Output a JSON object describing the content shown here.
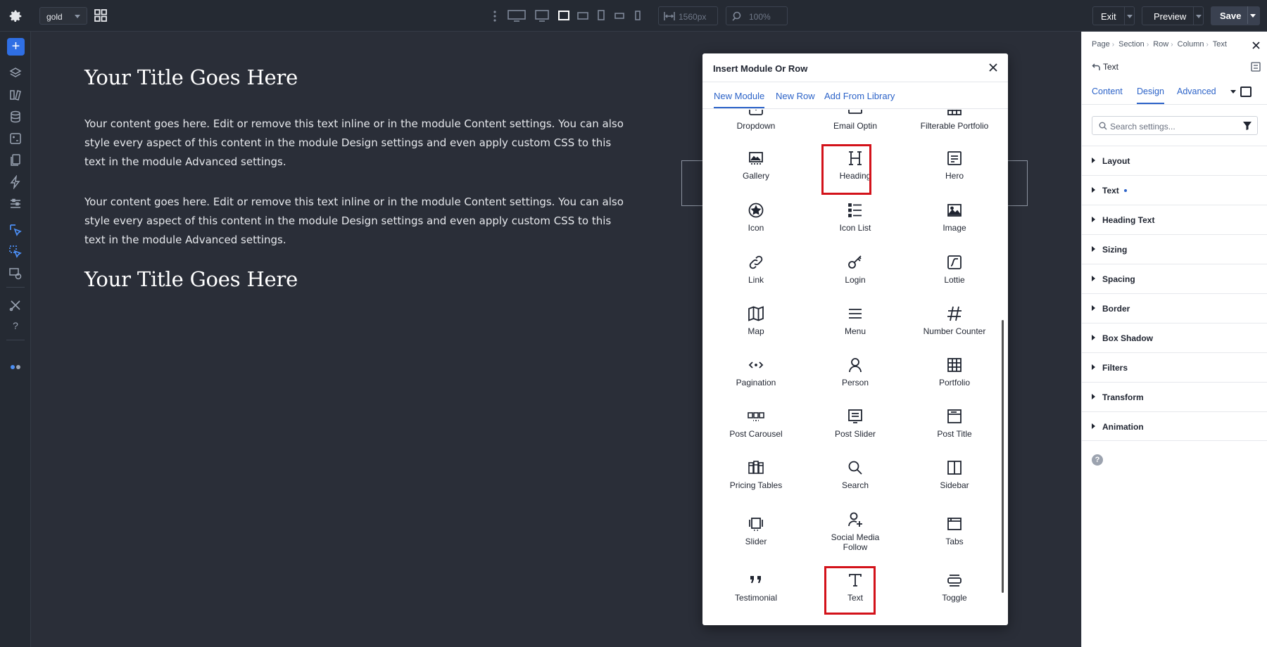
{
  "toolbar": {
    "layout_select": "gold",
    "width_value": "1560px",
    "zoom_value": "100%",
    "exit_label": "Exit",
    "preview_label": "Preview",
    "save_label": "Save"
  },
  "canvas": {
    "title_1": "Your Title Goes Here",
    "paragraph_1": "Your content goes here. Edit or remove this text inline or in the module Content settings. You can also style every aspect of this content in the module Design settings and even apply custom CSS to this text in the module Advanced settings.",
    "paragraph_2": "Your content goes here. Edit or remove this text inline or in the module Content settings. You can also style every aspect of this content in the module Design settings and even apply custom CSS to this text in the module Advanced settings.",
    "title_2": "Your Title Goes Here"
  },
  "modal": {
    "title": "Insert Module Or Row",
    "tabs": [
      "New Module",
      "New Row",
      "Add From Library"
    ],
    "modules": [
      {
        "label": "Dropdown",
        "icon": "dropdown-icon"
      },
      {
        "label": "Email Optin",
        "icon": "email-optin-icon"
      },
      {
        "label": "Filterable Portfolio",
        "icon": "filterable-portfolio-icon"
      },
      {
        "label": "Gallery",
        "icon": "gallery-icon"
      },
      {
        "label": "Heading",
        "icon": "heading-icon"
      },
      {
        "label": "Hero",
        "icon": "hero-icon"
      },
      {
        "label": "Icon",
        "icon": "star-circle-icon"
      },
      {
        "label": "Icon List",
        "icon": "icon-list-icon"
      },
      {
        "label": "Image",
        "icon": "image-icon"
      },
      {
        "label": "Link",
        "icon": "link-icon"
      },
      {
        "label": "Login",
        "icon": "key-icon"
      },
      {
        "label": "Lottie",
        "icon": "lottie-icon"
      },
      {
        "label": "Map",
        "icon": "map-icon"
      },
      {
        "label": "Menu",
        "icon": "menu-icon"
      },
      {
        "label": "Number Counter",
        "icon": "hash-icon"
      },
      {
        "label": "Pagination",
        "icon": "pagination-icon"
      },
      {
        "label": "Person",
        "icon": "person-icon"
      },
      {
        "label": "Portfolio",
        "icon": "portfolio-grid-icon"
      },
      {
        "label": "Post Carousel",
        "icon": "post-carousel-icon"
      },
      {
        "label": "Post Slider",
        "icon": "post-slider-icon"
      },
      {
        "label": "Post Title",
        "icon": "post-title-icon"
      },
      {
        "label": "Pricing Tables",
        "icon": "pricing-tables-icon"
      },
      {
        "label": "Search",
        "icon": "search-icon"
      },
      {
        "label": "Sidebar",
        "icon": "sidebar-icon"
      },
      {
        "label": "Slider",
        "icon": "slider-icon"
      },
      {
        "label": "Social Media Follow",
        "icon": "social-follow-icon"
      },
      {
        "label": "Tabs",
        "icon": "tabs-icon"
      },
      {
        "label": "Testimonial",
        "icon": "quote-icon"
      },
      {
        "label": "Text",
        "icon": "text-icon"
      },
      {
        "label": "Toggle",
        "icon": "toggle-icon"
      }
    ]
  },
  "panel": {
    "breadcrumb": [
      "Page",
      "Section",
      "Row",
      "Column",
      "Text"
    ],
    "element_title": "Text",
    "tabs": [
      "Content",
      "Design",
      "Advanced"
    ],
    "active_tab": "Design",
    "search_placeholder": "Search settings...",
    "sections": [
      "Layout",
      "Text",
      "Heading Text",
      "Sizing",
      "Spacing",
      "Border",
      "Box Shadow",
      "Filters",
      "Transform",
      "Animation"
    ],
    "help": "?"
  },
  "colors": {
    "accent": "#2c63c8",
    "highlight": "#d3121a",
    "canvas_bg": "#2a2e38"
  }
}
